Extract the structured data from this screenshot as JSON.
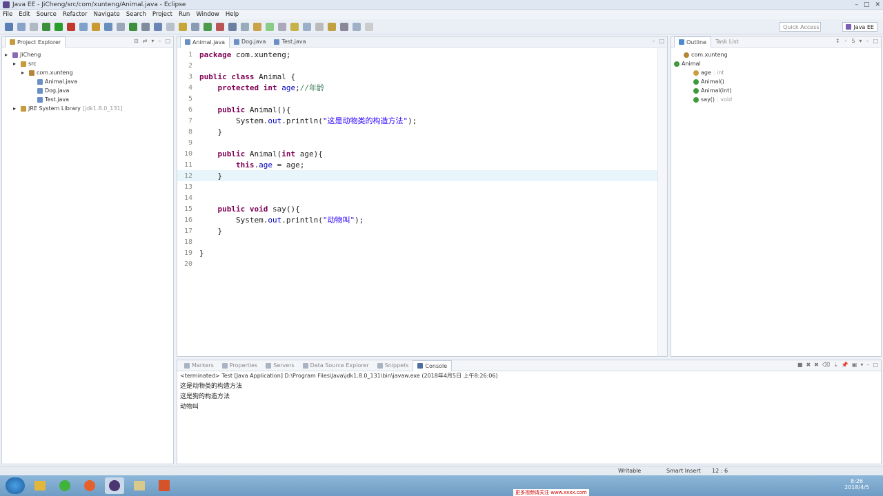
{
  "window": {
    "title": "Java EE - JiCheng/src/com/xunteng/Animal.java - Eclipse"
  },
  "menu": [
    "File",
    "Edit",
    "Source",
    "Refactor",
    "Navigate",
    "Search",
    "Project",
    "Run",
    "Window",
    "Help"
  ],
  "toolbar": {
    "quick_access": "Quick Access",
    "perspective": "Java EE"
  },
  "project_explorer": {
    "tab": "Project Explorer",
    "items": [
      {
        "label": "JiCheng",
        "level": 0
      },
      {
        "label": "src",
        "level": 1
      },
      {
        "label": "com.xunteng",
        "level": 2
      },
      {
        "label": "Animal.java",
        "level": 3
      },
      {
        "label": "Dog.java",
        "level": 3
      },
      {
        "label": "Test.java",
        "level": 3
      },
      {
        "label": "JRE System Library",
        "suffix": "[jdk1.8.0_131]",
        "level": 1
      }
    ]
  },
  "editor": {
    "tabs": [
      "Animal.java",
      "Dog.java",
      "Test.java"
    ],
    "active_tab": 0,
    "current_line": 12,
    "lines": [
      [
        {
          "t": "kw",
          "v": "package"
        },
        {
          "t": "",
          "v": " com.xunteng;"
        }
      ],
      [],
      [
        {
          "t": "kw",
          "v": "public class"
        },
        {
          "t": "",
          "v": " Animal {"
        }
      ],
      [
        {
          "t": "",
          "v": "    "
        },
        {
          "t": "kw",
          "v": "protected int"
        },
        {
          "t": "fld",
          "v": " age"
        },
        {
          "t": "",
          "v": ";"
        },
        {
          "t": "cmt",
          "v": "//年龄"
        }
      ],
      [],
      [
        {
          "t": "",
          "v": "    "
        },
        {
          "t": "kw",
          "v": "public"
        },
        {
          "t": "",
          "v": " Animal(){"
        }
      ],
      [
        {
          "t": "",
          "v": "        System."
        },
        {
          "t": "fld",
          "v": "out"
        },
        {
          "t": "",
          "v": ".println("
        },
        {
          "t": "str",
          "v": "\"这是动物类的构造方法\""
        },
        {
          "t": "",
          "v": ");"
        }
      ],
      [
        {
          "t": "",
          "v": "    }"
        }
      ],
      [],
      [
        {
          "t": "",
          "v": "    "
        },
        {
          "t": "kw",
          "v": "public"
        },
        {
          "t": "",
          "v": " Animal("
        },
        {
          "t": "kw",
          "v": "int"
        },
        {
          "t": "",
          "v": " age){"
        }
      ],
      [
        {
          "t": "",
          "v": "        "
        },
        {
          "t": "kw",
          "v": "this"
        },
        {
          "t": "",
          "v": "."
        },
        {
          "t": "fld",
          "v": "age"
        },
        {
          "t": "",
          "v": " = age;"
        }
      ],
      [
        {
          "t": "",
          "v": "    }"
        }
      ],
      [],
      [],
      [
        {
          "t": "",
          "v": "    "
        },
        {
          "t": "kw",
          "v": "public void"
        },
        {
          "t": "",
          "v": " say(){"
        }
      ],
      [
        {
          "t": "",
          "v": "        System."
        },
        {
          "t": "fld",
          "v": "out"
        },
        {
          "t": "",
          "v": ".println("
        },
        {
          "t": "str",
          "v": "\"动物叫\""
        },
        {
          "t": "",
          "v": ");"
        }
      ],
      [
        {
          "t": "",
          "v": "    }"
        }
      ],
      [],
      [
        {
          "t": "",
          "v": "}"
        }
      ],
      []
    ]
  },
  "outline": {
    "tab": "Outline",
    "tab2": "Task List",
    "items": [
      {
        "label": "com.xunteng",
        "detail": ""
      },
      {
        "label": "Animal",
        "detail": ""
      },
      {
        "label": "age",
        "detail": ": int"
      },
      {
        "label": "Animal()",
        "detail": ""
      },
      {
        "label": "Animal(int)",
        "detail": ""
      },
      {
        "label": "say()",
        "detail": ": void"
      }
    ]
  },
  "bottom": {
    "tabs": [
      "Markers",
      "Properties",
      "Servers",
      "Data Source Explorer",
      "Snippets",
      "Console"
    ],
    "active_tab": 5,
    "terminated": "<terminated> Test [Java Application] D:\\Program Files\\Java\\jdk1.8.0_131\\bin\\javaw.exe (2018年4月5日 上午8:26:06)",
    "output": [
      "这是动物类的构造方法",
      "这是狗的构造方法",
      "动物叫"
    ]
  },
  "status": {
    "writable": "Writable",
    "insert": "Smart Insert",
    "position": "12 : 6"
  },
  "taskbar": {
    "time": "8:26",
    "date": "2018/4/5",
    "banner": "更多视频请关注 www.xxxx.com"
  }
}
